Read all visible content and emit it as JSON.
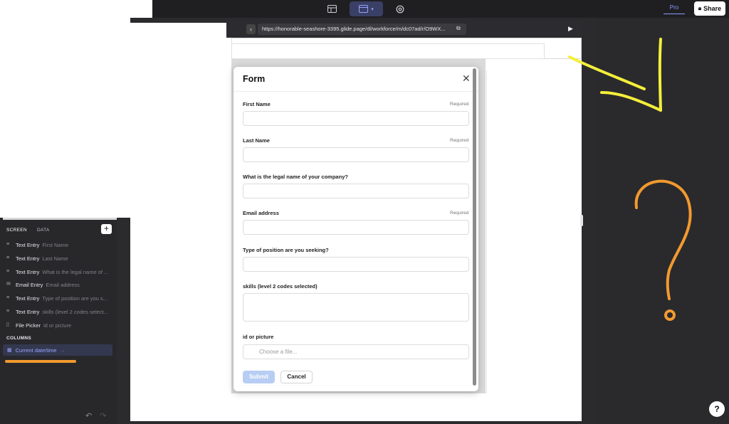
{
  "toolbar": {
    "icons": [
      "table-icon",
      "layout-icon",
      "settings-icon"
    ],
    "pro_label": "Pro",
    "share_label": "Share"
  },
  "browser": {
    "url": "https://honorable-seashore-3395.glide.page/dl/workforce/m/dc07ad/r/O9WX..."
  },
  "left_panel": {
    "tabs": [
      "SCREEN",
      "DATA"
    ],
    "items": [
      {
        "type": "Text Entry",
        "label": "First Name"
      },
      {
        "type": "Text Entry",
        "label": "Last Name"
      },
      {
        "type": "Text Entry",
        "label": "What is the legal name of ..."
      },
      {
        "type": "Email Entry",
        "label": "Email address"
      },
      {
        "type": "Text Entry",
        "label": "Type of position are you s..."
      },
      {
        "type": "Text Entry",
        "label": "skills (level 2 codes select..."
      },
      {
        "type": "File Picker",
        "label": "id or picture"
      }
    ],
    "columns_label": "COLUMNS",
    "column_item": "Current date/time"
  },
  "form": {
    "title": "Form",
    "required_label": "Required",
    "fields": [
      {
        "label": "First Name"
      },
      {
        "label": "Last Name"
      },
      {
        "label": "What is the legal name of your company?"
      },
      {
        "label": "Email address"
      },
      {
        "label": "Type of position are you seeking?"
      },
      {
        "label": "skills (level 2 codes selected)"
      },
      {
        "label": "id or picture"
      }
    ],
    "file_placeholder": "Choose a file...",
    "submit_label": "Submit",
    "cancel_label": "Cancel"
  },
  "help_label": "?",
  "colors": {
    "accent": "#8f99ff",
    "annotation_yellow": "#f4ef3a",
    "annotation_orange": "#f29a2e"
  }
}
